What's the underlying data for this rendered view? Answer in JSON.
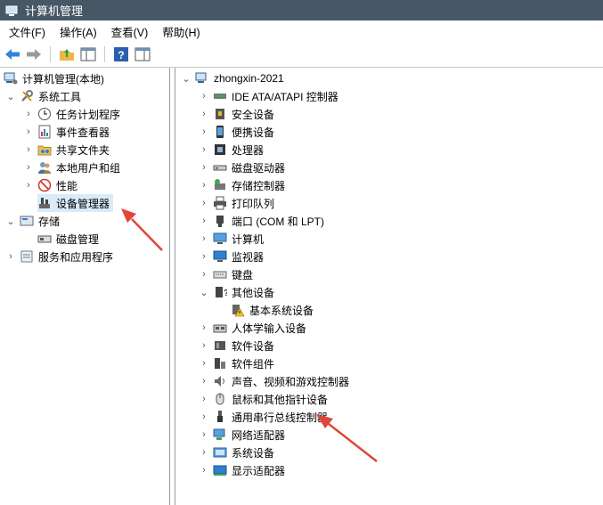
{
  "window": {
    "title": "计算机管理"
  },
  "menu": {
    "items": [
      "文件(F)",
      "操作(A)",
      "查看(V)",
      "帮助(H)"
    ]
  },
  "left_tree": {
    "root": "计算机管理(本地)",
    "system_tools": "系统工具",
    "task_scheduler": "任务计划程序",
    "event_viewer": "事件查看器",
    "shared_folders": "共享文件夹",
    "local_users": "本地用户和组",
    "performance": "性能",
    "device_manager": "设备管理器",
    "storage": "存储",
    "disk_management": "磁盘管理",
    "services_apps": "服务和应用程序"
  },
  "right_tree": {
    "computer_name": "zhongxin-2021",
    "categories": [
      "IDE ATA/ATAPI 控制器",
      "安全设备",
      "便携设备",
      "处理器",
      "磁盘驱动器",
      "存储控制器",
      "打印队列",
      "端口 (COM 和 LPT)",
      "计算机",
      "监视器",
      "键盘",
      "其他设备",
      "基本系统设备",
      "人体学输入设备",
      "软件设备",
      "软件组件",
      "声音、视频和游戏控制器",
      "鼠标和其他指针设备",
      "通用串行总线控制器",
      "网络适配器",
      "系统设备",
      "显示适配器"
    ]
  },
  "colors": {
    "titlebar": "#475766",
    "selection": "#d9ebf9",
    "annotation_arrow": "#e0463a"
  }
}
